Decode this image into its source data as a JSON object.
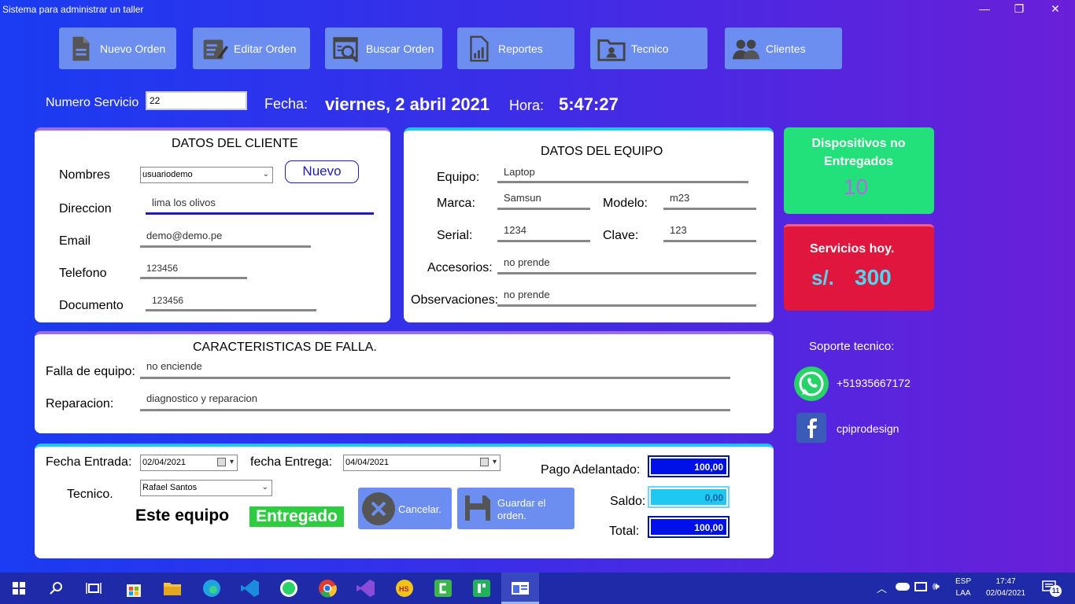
{
  "window": {
    "title": "Sistema para administrar un taller",
    "minimize": "—",
    "restore": "❐",
    "close": "✕"
  },
  "toolbar": [
    {
      "label": "Nuevo Orden",
      "icon": "document-icon"
    },
    {
      "label": "Editar Orden",
      "icon": "edit-form-icon"
    },
    {
      "label": "Buscar Orden",
      "icon": "search-document-icon"
    },
    {
      "label": "Reportes",
      "icon": "report-icon"
    },
    {
      "label": "Tecnico",
      "icon": "folder-user-icon"
    },
    {
      "label": "Clientes",
      "icon": "users-icon"
    }
  ],
  "header": {
    "numero_label": "Numero Servicio",
    "numero_value": "22",
    "fecha_label": "Fecha:",
    "fecha_value": "viernes, 2 abril 2021",
    "hora_label": "Hora:",
    "hora_value": "5:47:27"
  },
  "cliente": {
    "title": "DATOS DEL CLIENTE",
    "nombres_label": "Nombres",
    "nombres_value": "usuariodemo",
    "nuevo_button": "Nuevo",
    "direccion_label": "Direccion",
    "direccion_value": "lima los olivos",
    "email_label": "Email",
    "email_value": "demo@demo.pe",
    "telefono_label": "Telefono",
    "telefono_value": "123456",
    "documento_label": "Documento",
    "documento_value": "123456"
  },
  "equipo": {
    "title": "DATOS DEL EQUIPO",
    "equipo_label": "Equipo:",
    "equipo_value": "Laptop",
    "marca_label": "Marca:",
    "marca_value": "Samsun",
    "modelo_label": "Modelo:",
    "modelo_value": "m23",
    "serial_label": "Serial:",
    "serial_value": "1234",
    "clave_label": "Clave:",
    "clave_value": "123",
    "accesorios_label": "Accesorios:",
    "accesorios_value": "no prende",
    "observaciones_label": "Observaciones:",
    "observaciones_value": "no prende"
  },
  "falla": {
    "title": "CARACTERISTICAS DE FALLA.",
    "falla_label": "Falla de equipo:",
    "falla_value": "no enciende",
    "reparacion_label": "Reparacion:",
    "reparacion_value": "diagnostico y reparacion"
  },
  "orden": {
    "fecha_entrada_label": "Fecha Entrada:",
    "fecha_entrada_value": "02/04/2021",
    "fecha_entrega_label": "fecha Entrega:",
    "fecha_entrega_value": "04/04/2021",
    "tecnico_label": "Tecnico.",
    "tecnico_value": "Rafael Santos",
    "estado_prefix": "Este equipo",
    "estado_value": "Entregado",
    "cancelar_button": "Cancelar.",
    "guardar_button": "Guardar el orden.",
    "pago_label": "Pago Adelantado:",
    "pago_value": "100,00",
    "saldo_label": "Saldo:",
    "saldo_value": "0,00",
    "total_label": "Total:",
    "total_value": "100,00"
  },
  "cards": {
    "dispositivos_title": "Dispositivos no Entregados",
    "dispositivos_value": "10",
    "servicios_title": "Servicios hoy.",
    "servicios_currency": "s/.",
    "servicios_value": "300"
  },
  "soporte": {
    "title": "Soporte tecnico:",
    "whatsapp": "+51935667172",
    "facebook": "cpiprodesign"
  },
  "taskbar": {
    "lang_top": "ESP",
    "lang_bottom": "LAA",
    "time": "17:47",
    "date": "02/04/2021",
    "notifications": "11"
  },
  "colors": {
    "toolbar_button": "#6b8ef0",
    "green_card": "#22e07a",
    "red_card": "#e0163e",
    "entregado": "#2ecc40",
    "money_blue": "#0010e8",
    "saldo_cyan": "#1ec8f0"
  }
}
